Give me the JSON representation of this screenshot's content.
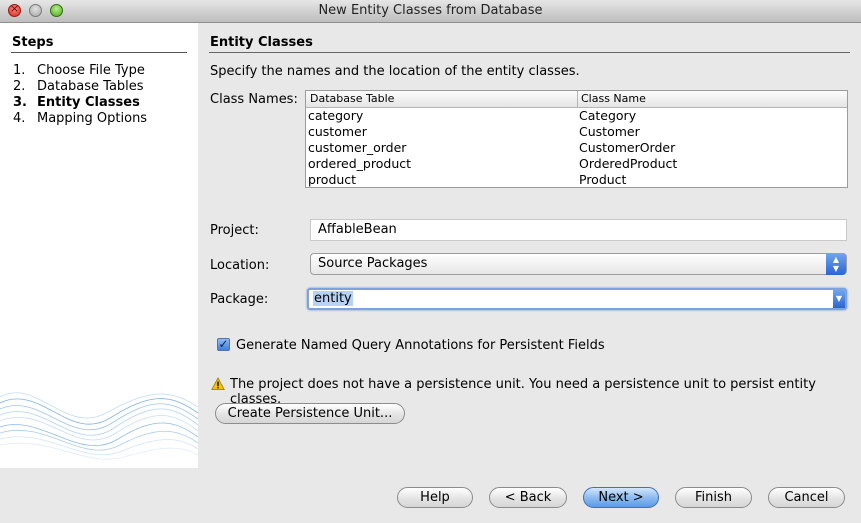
{
  "window": {
    "title": "New Entity Classes from Database"
  },
  "steps": {
    "title": "Steps",
    "items": [
      {
        "num": "1.",
        "label": "Choose File Type",
        "current": false
      },
      {
        "num": "2.",
        "label": "Database Tables",
        "current": false
      },
      {
        "num": "3.",
        "label": "Entity Classes",
        "current": true
      },
      {
        "num": "4.",
        "label": "Mapping Options",
        "current": false
      }
    ]
  },
  "panel": {
    "title": "Entity Classes",
    "description": "Specify the names and the location of the entity classes.",
    "class_names_label": "Class Names:",
    "table": {
      "columns": [
        "Database Table",
        "Class Name"
      ],
      "rows": [
        [
          "category",
          "Category"
        ],
        [
          "customer",
          "Customer"
        ],
        [
          "customer_order",
          "CustomerOrder"
        ],
        [
          "ordered_product",
          "OrderedProduct"
        ],
        [
          "product",
          "Product"
        ]
      ]
    },
    "project_label": "Project:",
    "project_value": "AffableBean",
    "location_label": "Location:",
    "location_value": "Source Packages",
    "package_label": "Package:",
    "package_value": "entity",
    "checkbox_label": "Generate Named Query Annotations for Persistent Fields",
    "checkbox_checked": true,
    "warning": "The project does not have a persistence unit. You need a persistence unit to persist entity classes.",
    "create_pu_button": "Create Persistence Unit..."
  },
  "buttons": {
    "help": "Help",
    "back": "< Back",
    "next": "Next >",
    "finish": "Finish",
    "cancel": "Cancel"
  },
  "colors": {
    "accent": "#3f7fdc",
    "steps_bg": "#ffffff",
    "dialog_bg": "#e8e8e8"
  }
}
